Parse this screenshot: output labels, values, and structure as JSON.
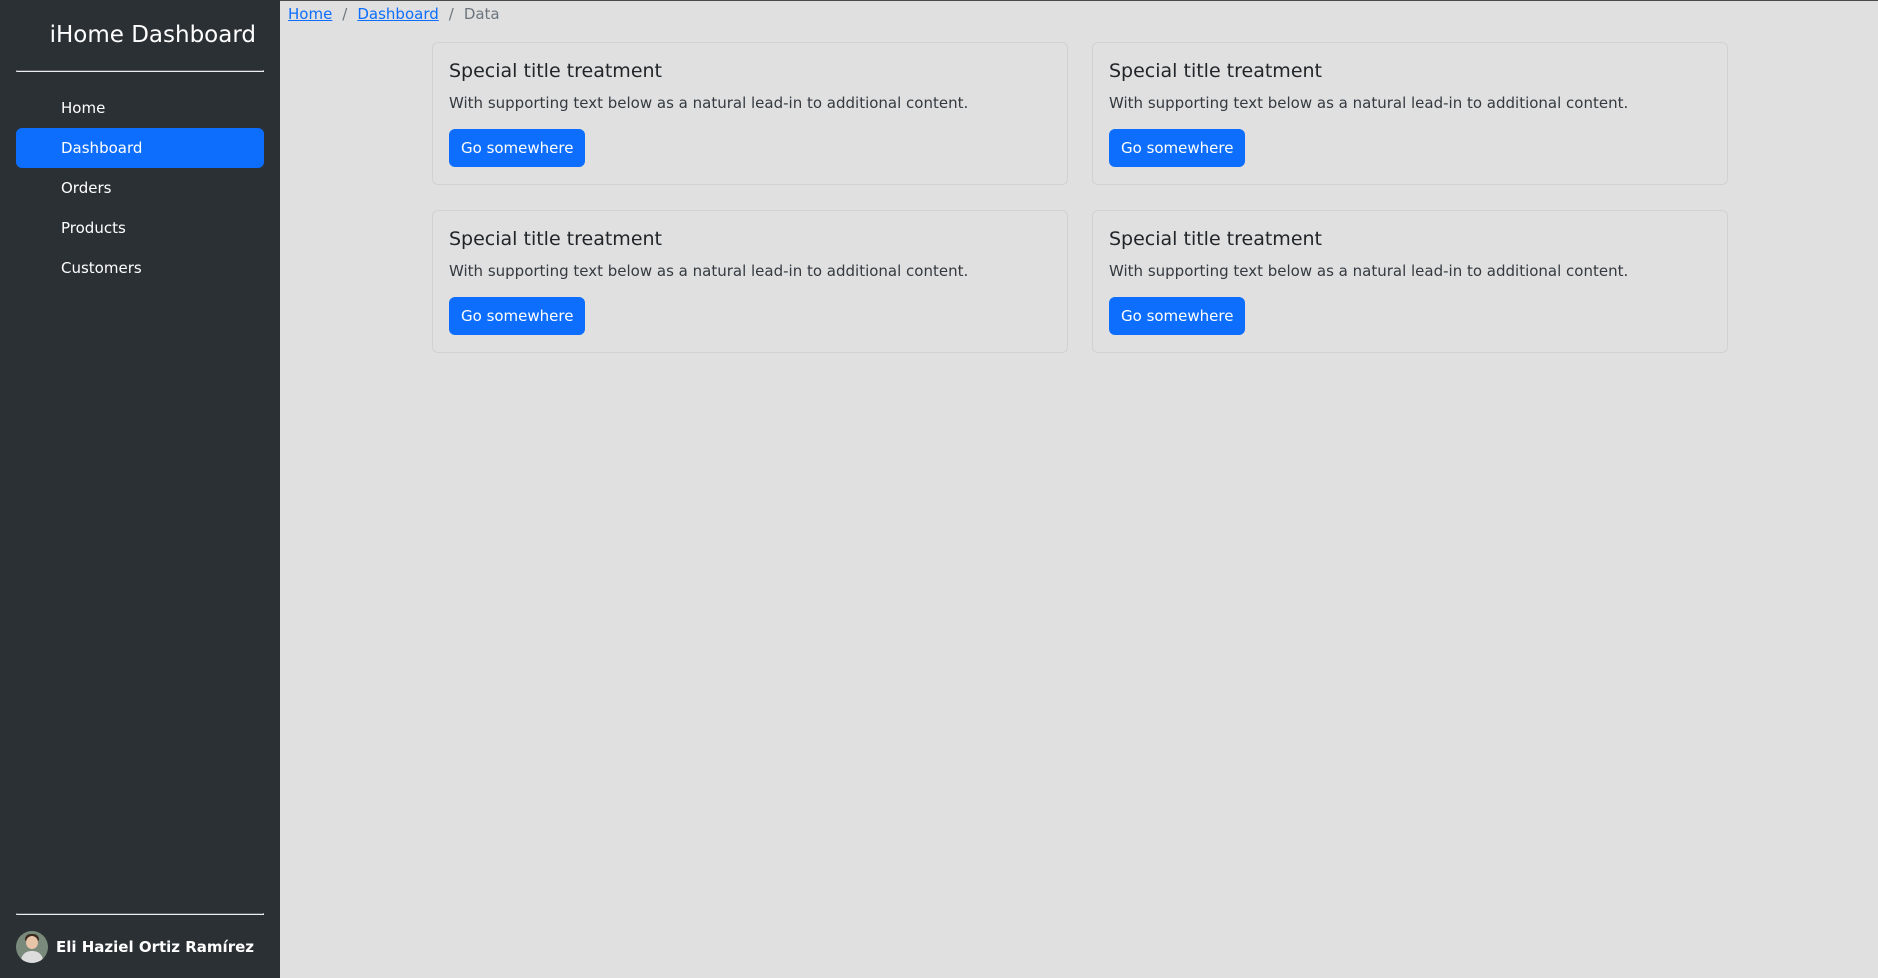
{
  "sidebar": {
    "brand": "iHome Dashboard",
    "items": [
      {
        "label": "Home",
        "active": false
      },
      {
        "label": "Dashboard",
        "active": true
      },
      {
        "label": "Orders",
        "active": false
      },
      {
        "label": "Products",
        "active": false
      },
      {
        "label": "Customers",
        "active": false
      }
    ],
    "user": {
      "name": "Eli Haziel Ortiz Ramírez",
      "avatar_icon": "user-avatar-photo"
    }
  },
  "breadcrumb": {
    "items": [
      {
        "label": "Home",
        "link": true
      },
      {
        "label": "Dashboard",
        "link": true
      },
      {
        "label": "Data",
        "link": false
      }
    ],
    "separator": "/"
  },
  "cards": [
    {
      "title": "Special title treatment",
      "text": "With supporting text below as a natural lead-in to additional content.",
      "button": "Go somewhere"
    },
    {
      "title": "Special title treatment",
      "text": "With supporting text below as a natural lead-in to additional content.",
      "button": "Go somewhere"
    },
    {
      "title": "Special title treatment",
      "text": "With supporting text below as a natural lead-in to additional content.",
      "button": "Go somewhere"
    },
    {
      "title": "Special title treatment",
      "text": "With supporting text below as a natural lead-in to additional content.",
      "button": "Go somewhere"
    }
  ],
  "colors": {
    "sidebar_bg": "#2b3035",
    "accent": "#0d6efd",
    "page_bg": "#e0e0e0"
  }
}
